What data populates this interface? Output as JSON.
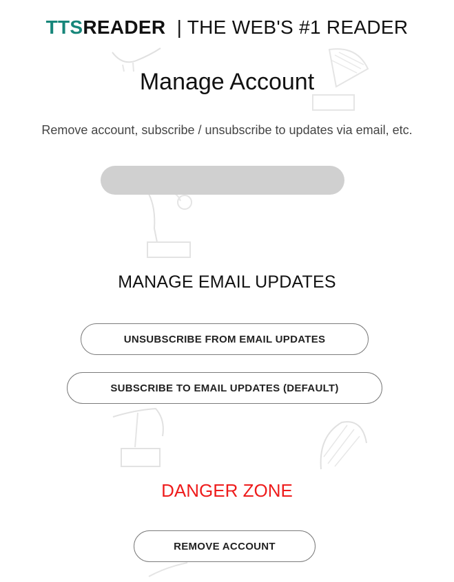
{
  "header": {
    "logo_part1": "TTS",
    "logo_part2": "READER",
    "separator": "|",
    "tagline": "THE WEB'S #1 READER"
  },
  "page": {
    "title": "Manage Account",
    "subtitle": "Remove account, subscribe / unsubscribe to updates via email, etc."
  },
  "email_section": {
    "title": "MANAGE EMAIL UPDATES",
    "unsubscribe_label": "UNSUBSCRIBE FROM EMAIL UPDATES",
    "subscribe_label": "SUBSCRIBE TO EMAIL UPDATES (DEFAULT)"
  },
  "danger_section": {
    "title": "DANGER ZONE",
    "remove_label": "REMOVE ACCOUNT"
  },
  "colors": {
    "brand_teal": "#17867a",
    "danger_red": "#ee1c1c",
    "button_border": "#7a7a7a",
    "redacted_fill": "#d0d0d0"
  },
  "icons": [
    "gramophone-watermark-icon"
  ]
}
